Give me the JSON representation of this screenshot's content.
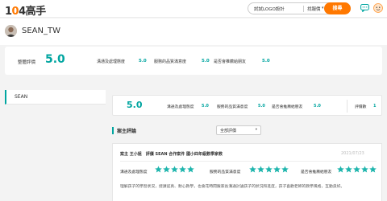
{
  "header": {
    "logo_prefix": "1",
    "logo_zero": "0",
    "logo_suffix": "4高手",
    "search_keyword": "試試LOGO設計",
    "search_type": "找報價",
    "search_button": "搜尋",
    "accent": "#ff7800"
  },
  "profile": {
    "name": "SEAN_TW"
  },
  "summary": {
    "avg_label": "整體評價",
    "avg_value": "5.0",
    "metrics": [
      {
        "label": "溝通及處理態度",
        "value": "5.0"
      },
      {
        "label": "服務的品質滿意度",
        "value": "5.0"
      },
      {
        "label": "是否會推薦給朋友",
        "value": "5.0"
      }
    ]
  },
  "sidebar": {
    "items": [
      {
        "label": "SEAN"
      }
    ]
  },
  "stats": {
    "avg_value": "5.0",
    "metrics": [
      {
        "label": "溝通及處理態度",
        "value": "5.0"
      },
      {
        "label": "服務的品質滿意度",
        "value": "5.0"
      },
      {
        "label": "是否會推薦給朋友",
        "value": "5.0"
      }
    ],
    "count_label": "評價數",
    "count_value": "1"
  },
  "reviews": {
    "title": "案主評論",
    "sort_label": "全部評價",
    "items": [
      {
        "header": "案主 王小姐　評價 SEAN 合作案件 國小四年級數學家教",
        "date": "2021/07/23",
        "ratings": [
          {
            "label": "溝通及處理態度",
            "stars": 5
          },
          {
            "label": "服務的品質滿意度",
            "stars": 5
          },
          {
            "label": "是否會推薦給朋友",
            "stars": 5
          }
        ],
        "body": "理解孩子的學習狀況，授課認真、耐心教學，也會花時間跟家長溝通討論孩子的狀況和進度，孩子喜歡老師的教學風格，互動良好。"
      }
    ]
  },
  "colors": {
    "teal": "#00a5a0",
    "star": "#1fb5ad"
  }
}
